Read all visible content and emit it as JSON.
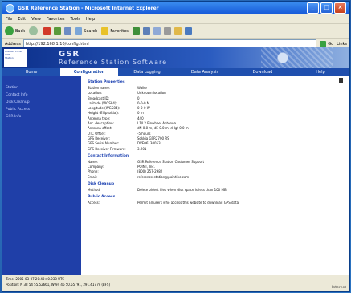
{
  "window": {
    "title": "GSR Reference Station - Microsoft Internet Explorer",
    "minimize": "_",
    "maximize": "□",
    "close": "×"
  },
  "menu": [
    "File",
    "Edit",
    "View",
    "Favorites",
    "Tools",
    "Help"
  ],
  "toolbar": {
    "back": "Back",
    "search": "Search",
    "favorites": "Favorites"
  },
  "address": {
    "label": "Address",
    "url": "http://192.168.1.10/config.html",
    "go": "Go",
    "links": "Links"
  },
  "banner": {
    "logo_lines": [
      "Created in full",
      "GSR",
      "Station"
    ],
    "brand": "GSR",
    "subtitle": "Reference Station Software"
  },
  "nav": {
    "tabs": [
      "Home",
      "Configuration",
      "Data Logging",
      "Data Analysis",
      "Download",
      "Help"
    ],
    "active_index": 1
  },
  "sidebar": [
    "Station",
    "Contact Info",
    "Disk Cleanup",
    "Public Access",
    "GSR Info"
  ],
  "sections": {
    "station": {
      "title": "Station Properties",
      "rows": [
        {
          "k": "Station name:",
          "v": "Walke"
        },
        {
          "k": "Location:",
          "v": "Unknown location"
        },
        {
          "k": "Broadcast ID:",
          "v": "0"
        },
        {
          "k": "Latitude (WGS84):",
          "v": "0-0-0 N"
        },
        {
          "k": "Longitude (WGS84):",
          "v": "0-0-0 W"
        },
        {
          "k": "Height (Ellipsoidal):",
          "v": "0 m"
        },
        {
          "k": "Antenna type:",
          "v": "440"
        },
        {
          "k": "Ant. description:",
          "v": "L1/L2 Pinwheel Antenna"
        },
        {
          "k": "Antenna offset:",
          "v": "dN 0.0 m, dE 0.0 m, dHgt 0.0 m"
        },
        {
          "k": "UTC Offset:",
          "v": "-5 hours"
        },
        {
          "k": "GPS Receiver:",
          "v": "Sokkia GSR2700 RS"
        },
        {
          "k": "GPS Serial Number:",
          "v": "DVE06130053"
        },
        {
          "k": "GPS Receiver Firmware:",
          "v": "3.201"
        }
      ]
    },
    "contact": {
      "title": "Contact Information",
      "rows": [
        {
          "k": "Name:",
          "v": "GSR Reference Station Customer Support"
        },
        {
          "k": "Company:",
          "v": "POINT, Inc."
        },
        {
          "k": "Phone:",
          "v": "(800) 257-2982"
        },
        {
          "k": "Email:",
          "v": "reference-station@pointinc.com"
        }
      ]
    },
    "disk": {
      "title": "Disk Cleanup",
      "rows": [
        {
          "k": "Method:",
          "v": "Delete oldest files when disk space is less than 100 MB."
        }
      ]
    },
    "public": {
      "title": "Public Access",
      "rows": [
        {
          "k": "Access:",
          "v": "Permit all users who access this website to download GPS data."
        }
      ]
    }
  },
  "status": {
    "time": "Time: 2005-03-07 20:40:40.038 UTC",
    "position": "Position: N 38 54 55.52661, W 94 46 50.55791, 291.417 m (BFS)",
    "zone": "Internet"
  }
}
